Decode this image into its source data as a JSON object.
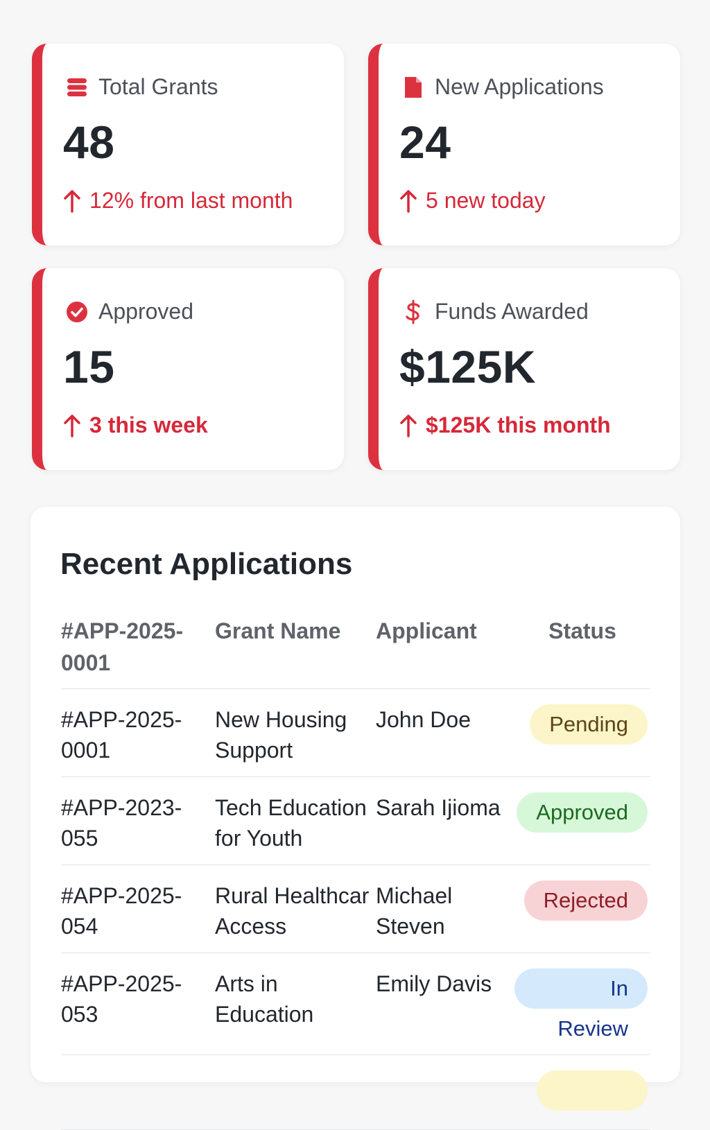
{
  "stats": [
    {
      "label": "Total Grants",
      "value": "48",
      "trend": "12% from last month",
      "icon": "database-icon"
    },
    {
      "label": "New Applications",
      "value": "24",
      "trend": "5 new today",
      "icon": "file-icon"
    },
    {
      "label": "Approved",
      "value": "15",
      "trend": "3 this week",
      "icon": "check-circle-icon"
    },
    {
      "label": "Funds Awarded",
      "value": "$125K",
      "trend": "$125K this month",
      "icon": "dollar-icon"
    }
  ],
  "recent": {
    "title": "Recent Applications",
    "headers": [
      "#APP-2025-0001",
      "Grant Name",
      "Applicant",
      "Status"
    ],
    "rows": [
      {
        "id": "#APP-2025-0001",
        "grant": "New Housing Support",
        "applicant": "John Doe",
        "status": "Pending"
      },
      {
        "id": "#APP-2023-055",
        "grant": "Tech Education for Youth",
        "applicant": "Sarah Ijioma",
        "status": "Approved"
      },
      {
        "id": "#APP-2025-054",
        "grant": "Rural Healthcar Access",
        "applicant": "Michael Steven",
        "status": "Rejected"
      },
      {
        "id": "#APP-2025-053",
        "grant": "Arts in Education",
        "applicant": "Emily Davis",
        "status": "In Review"
      }
    ]
  },
  "colors": {
    "accent": "#dc3240",
    "pending_bg": "#fbf5c9",
    "approved_bg": "#d7f7d9",
    "rejected_bg": "#f8d3d6",
    "review_bg": "#d4e9fb"
  }
}
